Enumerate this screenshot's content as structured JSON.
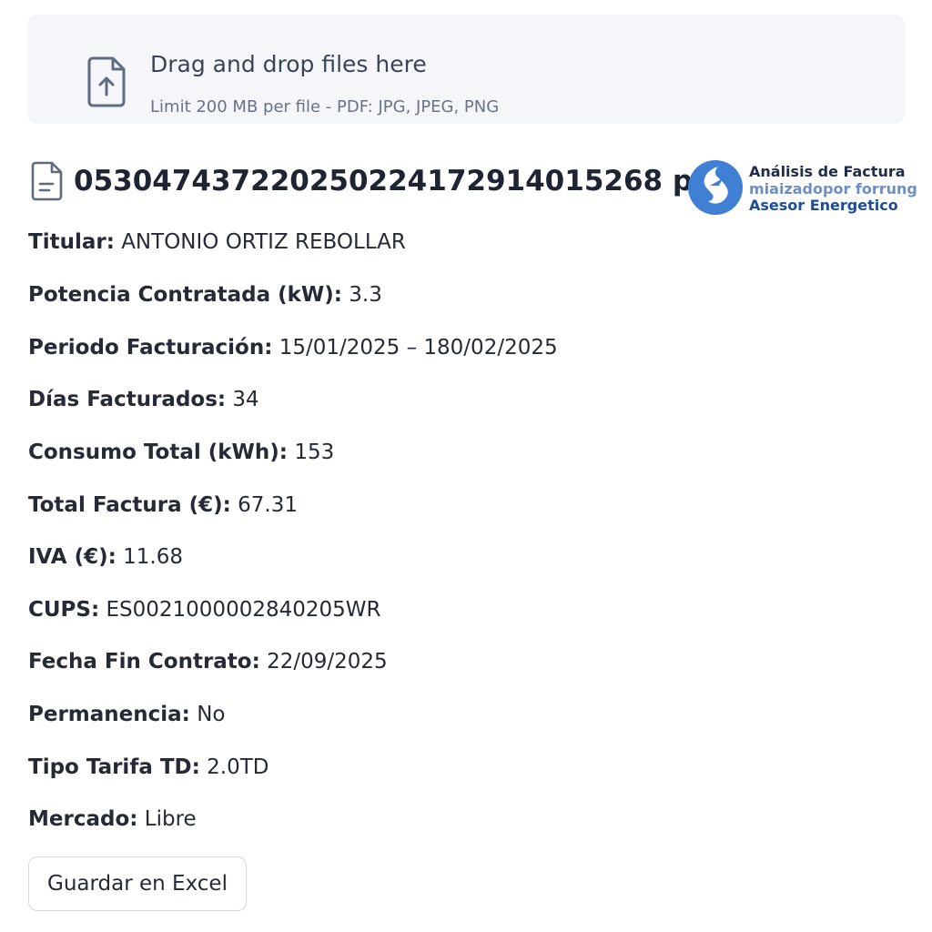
{
  "uploader": {
    "title": "Drag and drop files here",
    "subtitle": "Limit 200 MB per file - PDF: JPG, JPEG, PNG",
    "icon": "file-upload-icon"
  },
  "file": {
    "name": "05304743722025022417291401526​8 pdf",
    "icon": "document-icon"
  },
  "brand": {
    "line1": "Análisis de Factura",
    "line2": "miaizadopor forrung",
    "line3": "Asesor Energetico",
    "logo_icon": "energy-logo-icon",
    "colors": {
      "logo_blue": "#3f7fd4",
      "line1": "#1f2d4a",
      "line2": "#6e8fc6",
      "line3": "#1f4c9a"
    }
  },
  "fields": [
    {
      "label": "Titular:",
      "value": "ANTONIO ORTIZ REBOLLAR"
    },
    {
      "label": "Potencia Contratada (kW):",
      "value": "3.3"
    },
    {
      "label": "Periodo Facturación:",
      "value": "15/01/2025 – 180/02/2025"
    },
    {
      "label": "Días Facturados:",
      "value": "34"
    },
    {
      "label": "Consumo Total (kWh):",
      "value": "153"
    },
    {
      "label": "Total Factura (€):",
      "value": "67.31"
    },
    {
      "label": "IVA (€):",
      "value": "11.68"
    },
    {
      "label": "CUPS:",
      "value": "ES0021000002840205WR"
    },
    {
      "label": "Fecha Fin Contrato:",
      "value": "22/09/2025"
    },
    {
      "label": "Permanencia:",
      "value": "No"
    },
    {
      "label": "Tipo Tarifa TD:",
      "value": "2.0TD"
    },
    {
      "label": "Mercado:",
      "value": "Libre"
    }
  ],
  "actions": {
    "save_label": "Guardar en Excel"
  }
}
